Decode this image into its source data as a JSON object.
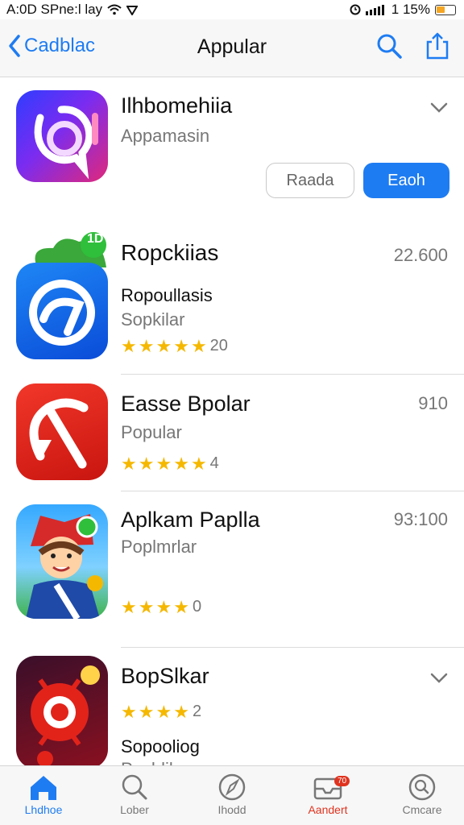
{
  "status_bar": {
    "time_carrier": "A:0D SPne:l lay",
    "battery_percent": "1 15%"
  },
  "nav": {
    "back_label": "Cadblac",
    "title": "Appular"
  },
  "featured": {
    "title": "Ilhbomehiia",
    "subtitle": "Appamasin",
    "secondary_button": "Raada",
    "primary_button": "Eaoh"
  },
  "list": [
    {
      "title": "Ropckiias",
      "subtitle": "Ropoullasis",
      "category": "Sopkilar",
      "price": "22.600",
      "rating_count": "20",
      "badge": "1D"
    },
    {
      "title": "Easse Bpolar",
      "subtitle": "Popular",
      "price": "910",
      "rating_count": "4"
    },
    {
      "title": "Aplkam Paplla",
      "subtitle": "Poplmrlar",
      "price": "93:100",
      "rating_count": "0"
    },
    {
      "title": "BopSlkar",
      "subtitle": "Sopooliog",
      "category": "Pochlilar",
      "rating_count": "2"
    }
  ],
  "tabs": [
    {
      "label": "Lhdhoe",
      "icon": "home-icon"
    },
    {
      "label": "Lober",
      "icon": "search-icon"
    },
    {
      "label": "Ihodd",
      "icon": "compass-icon"
    },
    {
      "label": "Aandert",
      "icon": "inbox-icon",
      "badge": "70"
    },
    {
      "label": "Cmcare",
      "icon": "search-circle-icon"
    }
  ],
  "colors": {
    "accent": "#1e7cf2",
    "star": "#f5b800",
    "alert": "#e0331f"
  }
}
